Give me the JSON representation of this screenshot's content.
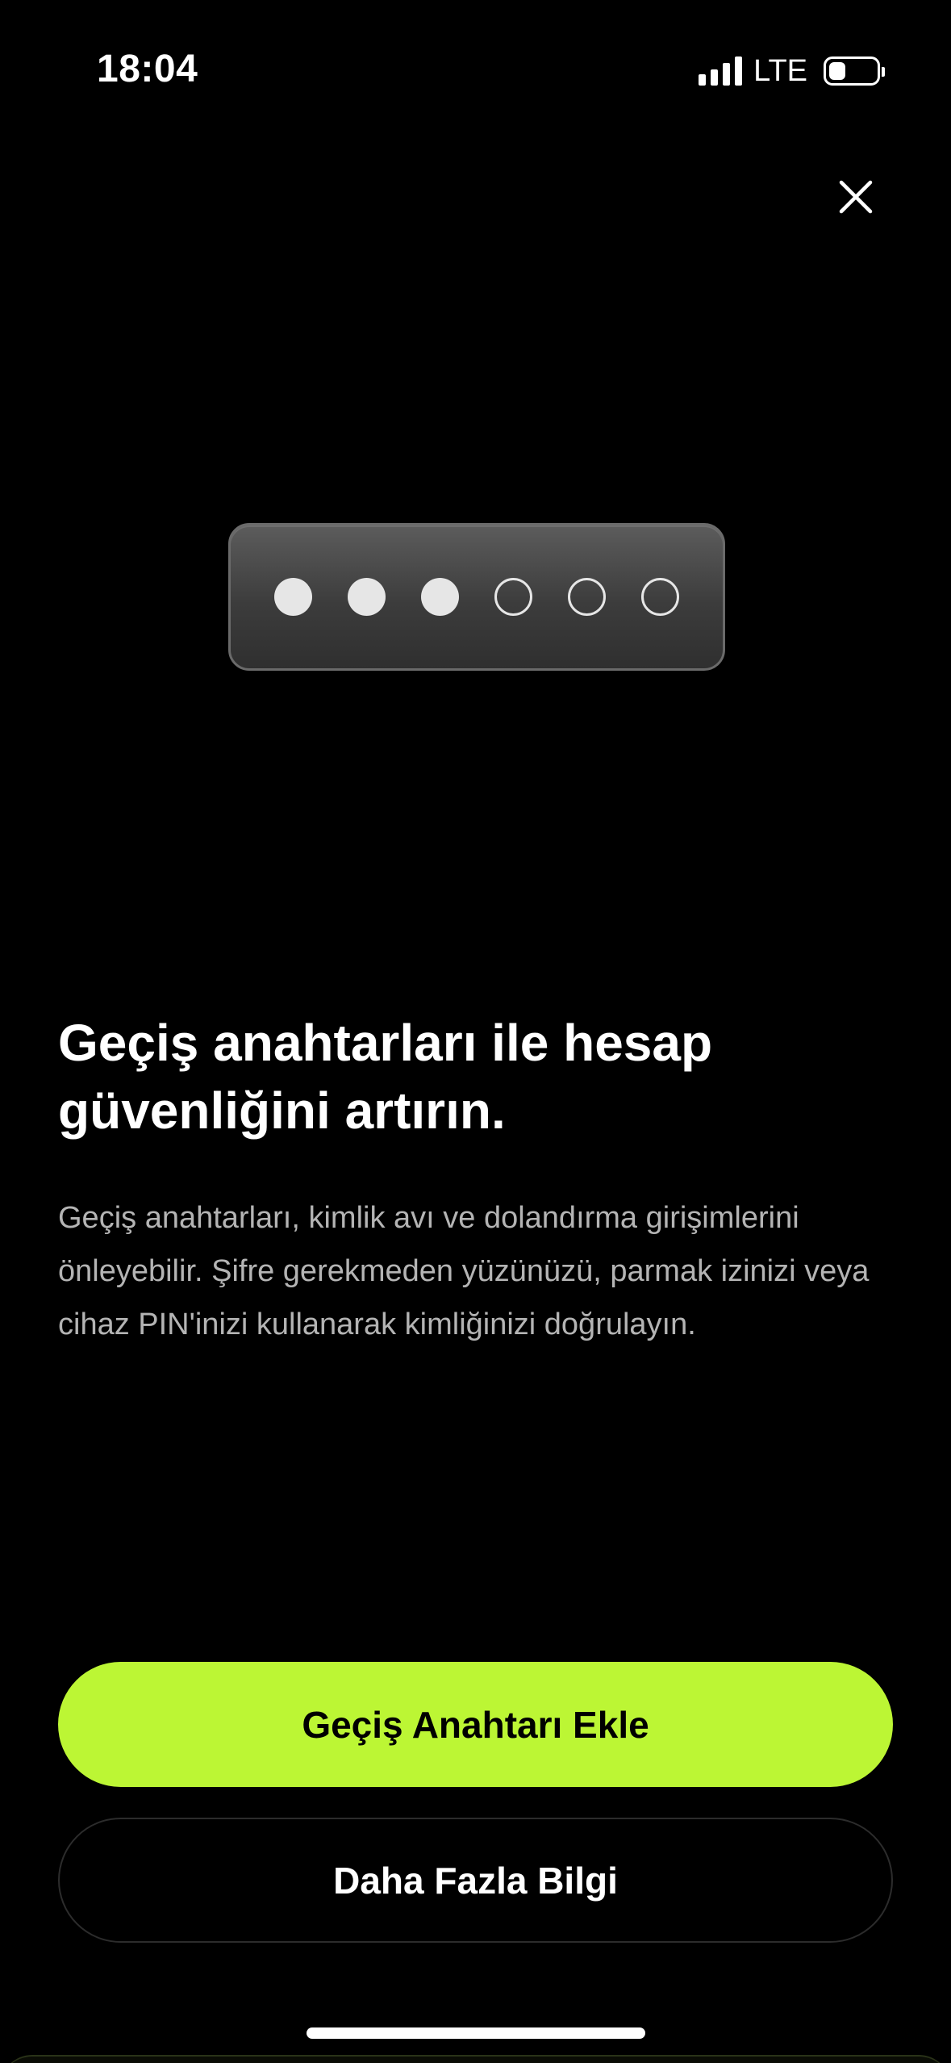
{
  "status_bar": {
    "time": "18:04",
    "network": "LTE",
    "signal_icon": "cellular-signal-icon",
    "battery_icon": "battery-icon"
  },
  "close": {
    "icon": "close-icon"
  },
  "illustration": {
    "pin_total": 6,
    "pin_filled": 3
  },
  "content": {
    "headline": "Geçiş anahtarları ile hesap güvenliğini artırın.",
    "description": "Geçiş anahtarları, kimlik avı ve dolandırma girişimlerini önleyebilir. Şifre gerekmeden yüzünüzü, parmak izinizi veya cihaz PIN'inizi kullanarak kimliğinizi doğrulayın."
  },
  "actions": {
    "primary_label": "Geçiş Anahtarı Ekle",
    "secondary_label": "Daha Fazla Bilgi"
  },
  "colors": {
    "background": "#000000",
    "accent": "#bcf634",
    "body_text": "#b4b4b4"
  }
}
